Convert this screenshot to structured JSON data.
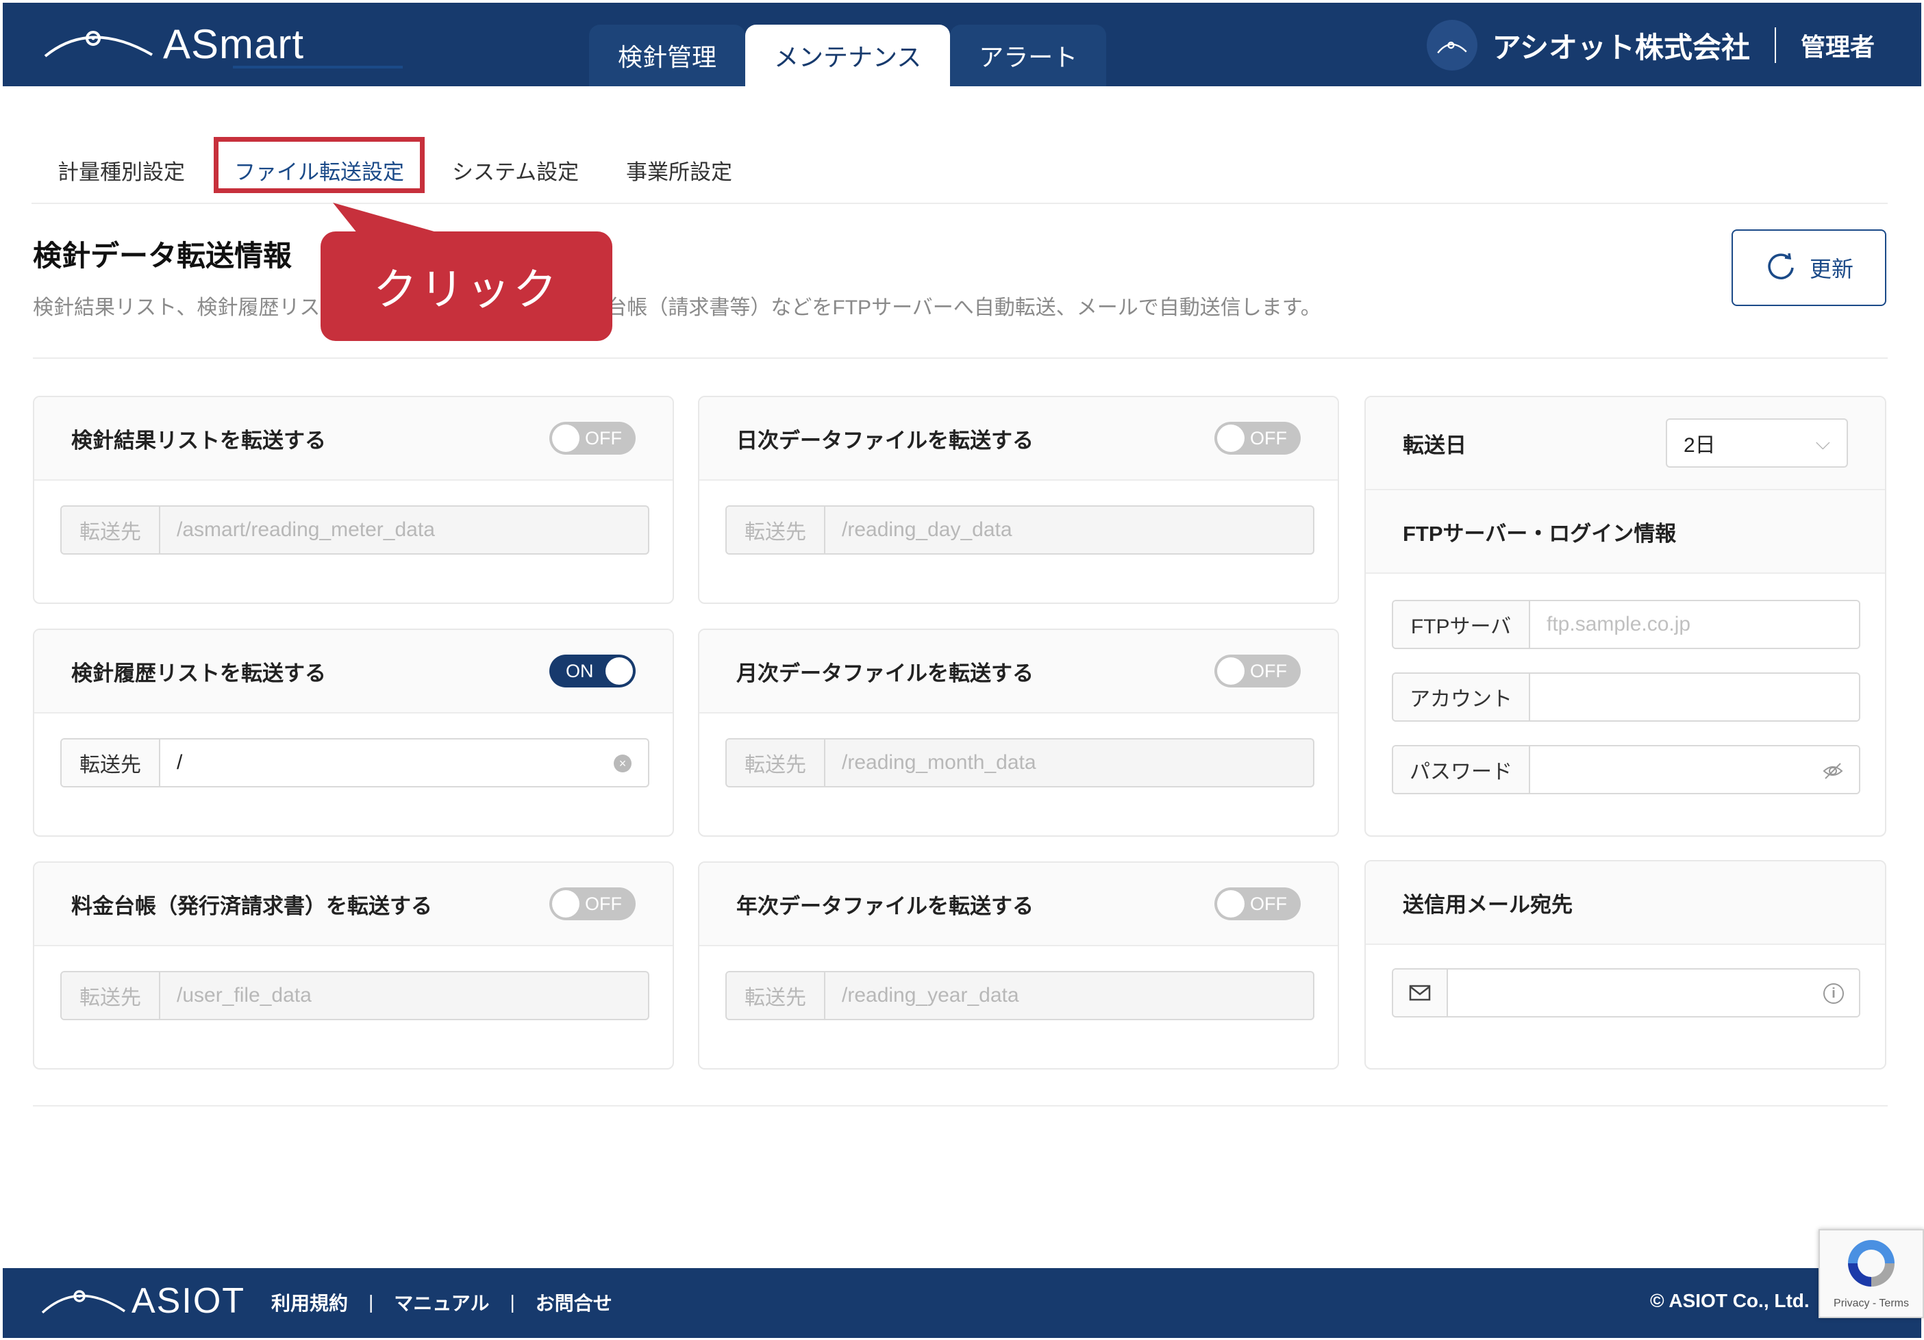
{
  "header": {
    "logo_text": "ASmart",
    "tabs": [
      {
        "label": "検針管理"
      },
      {
        "label": "メンテナンス"
      },
      {
        "label": "アラート"
      }
    ],
    "company_name": "アシオット株式会社",
    "role": "管理者"
  },
  "sub_tabs": [
    {
      "label": "計量種別設定"
    },
    {
      "label": "ファイル転送設定"
    },
    {
      "label": "システム設定"
    },
    {
      "label": "事業所設定"
    }
  ],
  "callout": {
    "label": "クリック"
  },
  "section": {
    "title": "検針データ転送情報",
    "description_left": "検針結果リスト、検針履歴リス",
    "description_right": "台帳（請求書等）などをFTPサーバーへ自動転送、メールで自動送信します。",
    "refresh_label": "更新"
  },
  "cards": [
    {
      "title": "検針結果リストを転送する",
      "toggle": "OFF",
      "addon": "転送先",
      "placeholder": "/asmart/reading_meter_data",
      "value": ""
    },
    {
      "title": "日次データファイルを転送する",
      "toggle": "OFF",
      "addon": "転送先",
      "placeholder": "/reading_day_data",
      "value": ""
    },
    {
      "title": "検針履歴リストを転送する",
      "toggle": "ON",
      "addon": "転送先",
      "placeholder": "",
      "value": "/"
    },
    {
      "title": "月次データファイルを転送する",
      "toggle": "OFF",
      "addon": "転送先",
      "placeholder": "/reading_month_data",
      "value": ""
    },
    {
      "title": "料金台帳（発行済請求書）を転送する",
      "toggle": "OFF",
      "addon": "転送先",
      "placeholder": "/user_file_data",
      "value": ""
    },
    {
      "title": "年次データファイルを転送する",
      "toggle": "OFF",
      "addon": "転送先",
      "placeholder": "/reading_year_data",
      "value": ""
    }
  ],
  "transfer_day": {
    "label": "転送日",
    "selected": "2日"
  },
  "ftp": {
    "title": "FTPサーバー・ログイン情報",
    "server_label": "FTPサーバ",
    "server_placeholder": "ftp.sample.co.jp",
    "account_label": "アカウント",
    "password_label": "パスワード"
  },
  "mail": {
    "title": "送信用メール宛先"
  },
  "footer": {
    "logo_text": "ASIOT",
    "links": [
      {
        "label": "利用規約"
      },
      {
        "label": "マニュアル"
      },
      {
        "label": "お問合せ"
      }
    ],
    "copyright": "© ASIOT Co., Ltd."
  },
  "recaptcha": {
    "text": "Privacy - Terms"
  },
  "colors": {
    "brand": "#173a6d",
    "accent": "#1b4a88",
    "callout": "#c7303c"
  }
}
